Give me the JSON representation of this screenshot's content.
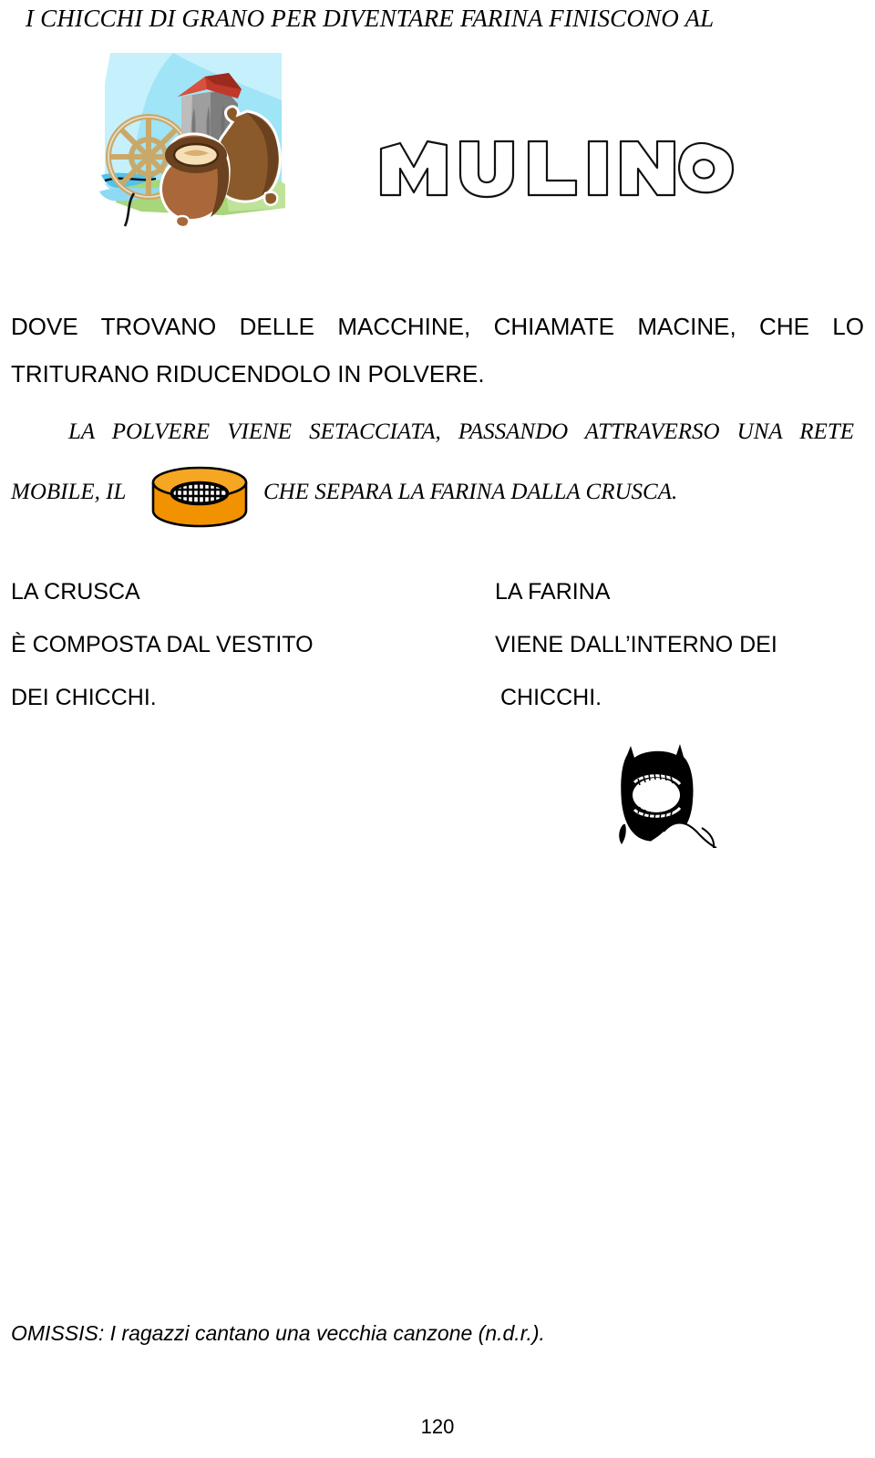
{
  "document": {
    "title": "I CHICCHI DI GRANO PER DIVENTARE FARINA FINISCONO AL",
    "page_number": "120"
  },
  "illustrations": {
    "mill": {
      "name": "mill-clipart",
      "alt": "Mulino ad acqua con ruota e sacchi di grano",
      "colors": {
        "sky": "#9fe4f7",
        "sky_light": "#c9f1fb",
        "grass": "#a8d67a",
        "water": "#4fc3ef",
        "roof": "#c0392b",
        "tower": "#9e9e9e",
        "tower_dark": "#6e6e6e",
        "wheel": "#c9a96a",
        "sack": "#8b5a2b",
        "sack_light": "#a9673a",
        "sack_dark": "#6b4220",
        "grain": "#f5e0b8"
      }
    },
    "mulino_word": {
      "name": "mulino-outline-word",
      "text": "MULINO",
      "style": "outline-bubble-letters",
      "stroke": "#000000"
    },
    "sieve": {
      "name": "sieve-drawing",
      "alt": "Setaccio arancione con rete",
      "colors": {
        "body": "#F39200",
        "top": "#F5A623",
        "stroke": "#000000",
        "mesh": "#ffffff"
      }
    },
    "flour_sack": {
      "name": "flour-sack-silhouette",
      "alt": "Sacco di farina nero con spighe e farina versata",
      "colors": {
        "body": "#000000",
        "label": "#ffffff"
      }
    }
  },
  "body": {
    "paragraph_sans": {
      "line1": "DOVE TROVANO DELLE MACCHINE, CHIAMATE MACINE, CHE LO",
      "line2": "TRITURANO RIDUCENDOLO IN POLVERE."
    },
    "paragraph_serif": {
      "line1": "LA POLVERE VIENE SETACCIATA, PASSANDO ATTRAVERSO UNA RETE",
      "line2_before_icon": "MOBILE, IL",
      "line2_after_icon": "CHE SEPARA LA FARINA DALLA CRUSCA."
    }
  },
  "columns": {
    "left": {
      "heading": "LA CRUSCA",
      "line2": "È COMPOSTA DAL VESTITO",
      "line3": "DEI CHICCHI."
    },
    "right": {
      "heading": "LA FARINA",
      "line2": "VIENE DALL’INTERNO DEI",
      "line3": "CHICCHI."
    }
  },
  "footer": {
    "note": "OMISSIS: I ragazzi cantano una vecchia canzone (n.d.r.)."
  }
}
